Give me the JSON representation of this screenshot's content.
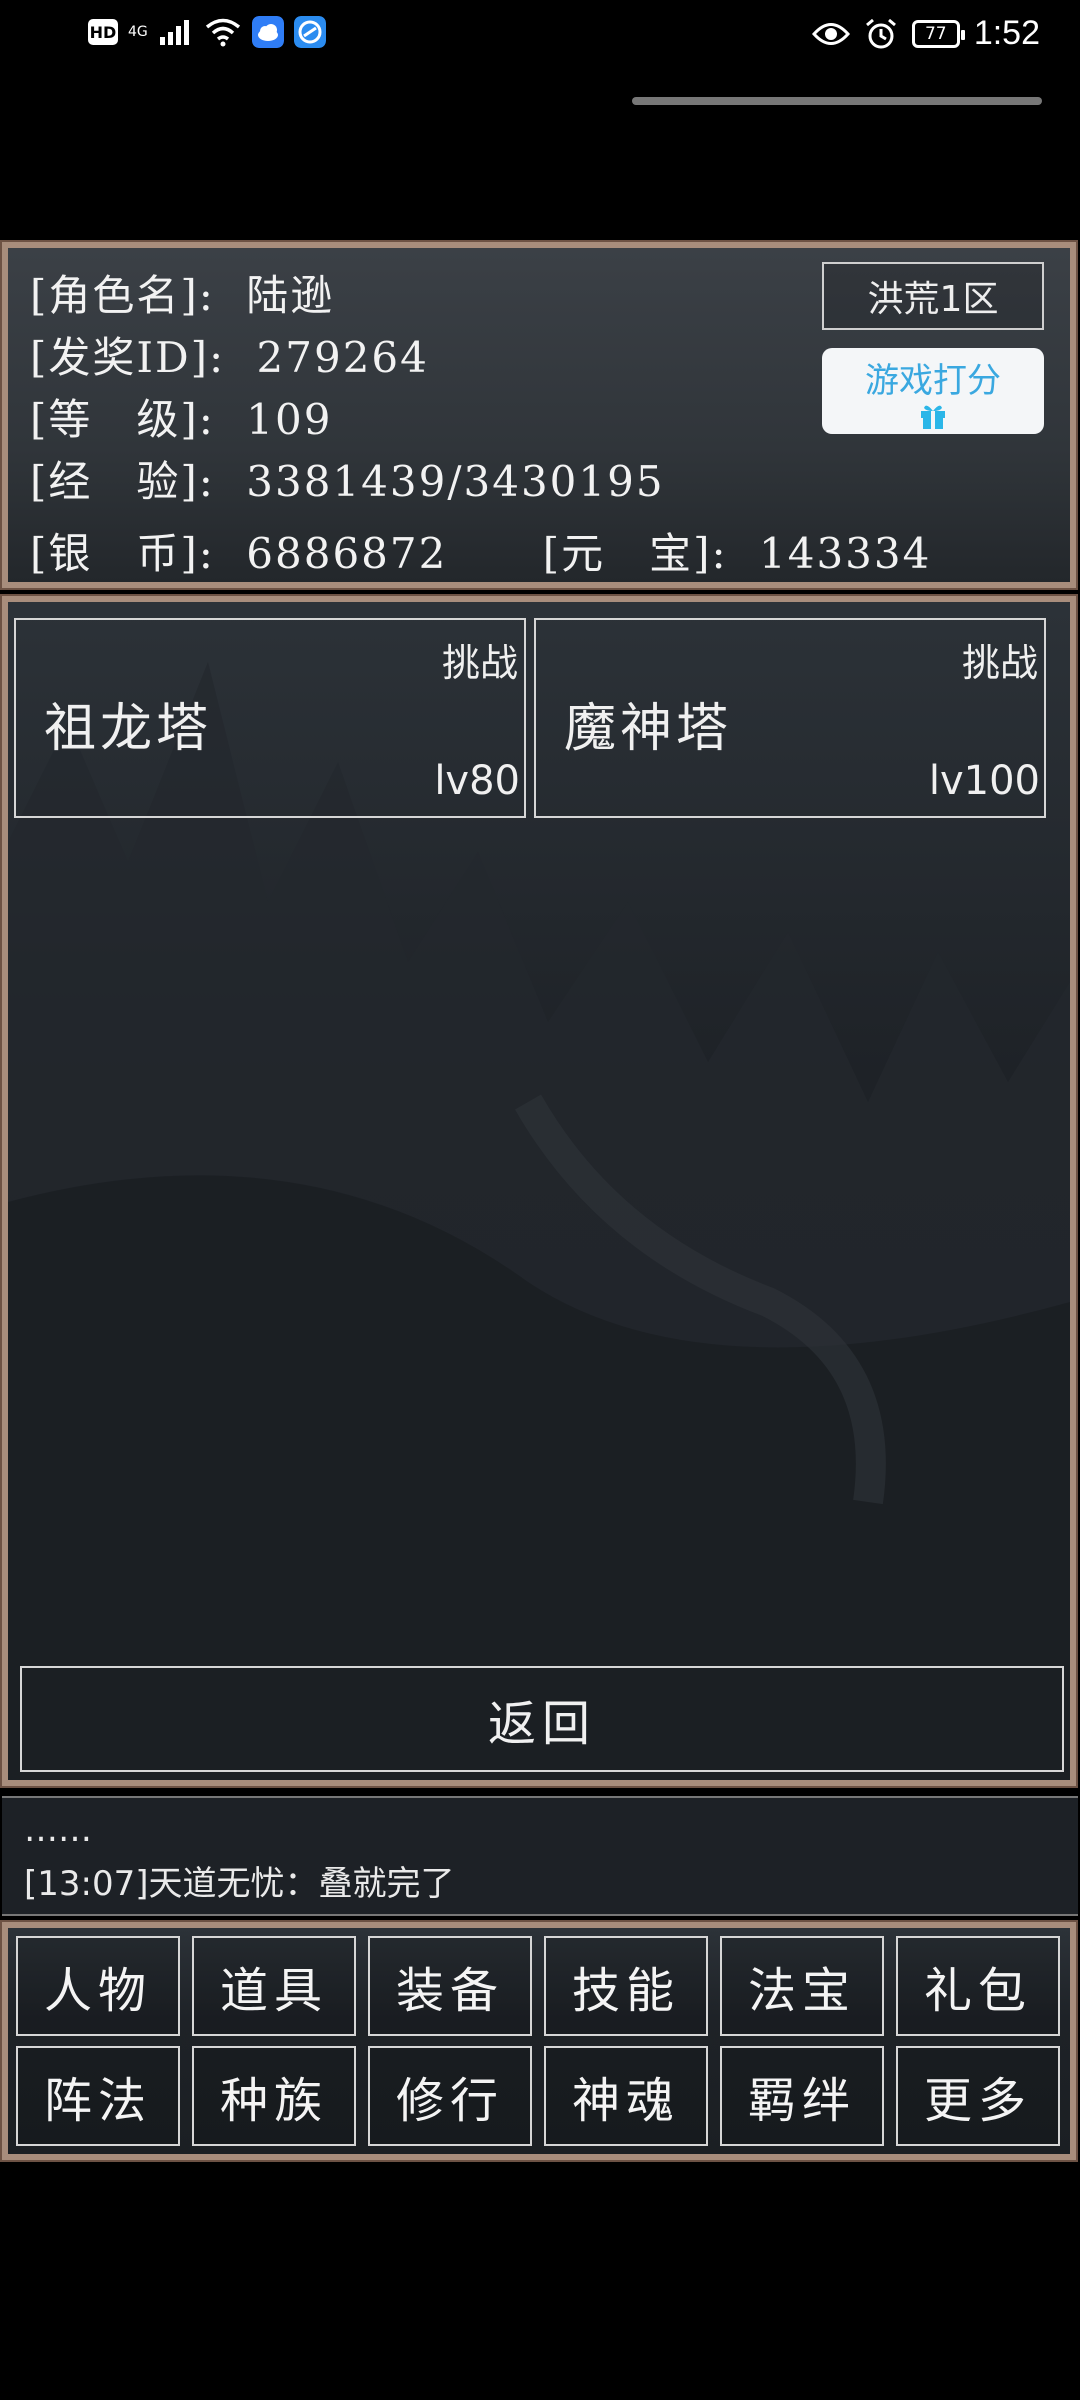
{
  "status_bar": {
    "hd_badge": "HD",
    "network": "4G",
    "battery": "77",
    "time": "1:52"
  },
  "player_info": {
    "name_label": "[角色名]:",
    "name_value": "陆逊",
    "id_label": "[发奖ID]:",
    "id_value": "279264",
    "level_label": "[等　级]:",
    "level_value": "109",
    "exp_label": "[经　验]:",
    "exp_value": "3381439/3430195",
    "silver_label": "[银　币]:",
    "silver_value": "6886872",
    "yuanbao_label": "[元　宝]:",
    "yuanbao_value": "143334",
    "server": "洪荒1区",
    "rate_game": "游戏打分"
  },
  "towers": [
    {
      "name": "祖龙塔",
      "challenge": "挑战",
      "level": "lv80"
    },
    {
      "name": "魔神塔",
      "challenge": "挑战",
      "level": "lv100"
    }
  ],
  "back_label": "返回",
  "chat": {
    "line1": "……",
    "line2": "[13:07]天道无忧：叠就完了"
  },
  "menu": [
    "人物",
    "道具",
    "装备",
    "技能",
    "法宝",
    "礼包",
    "阵法",
    "种族",
    "修行",
    "神魂",
    "羁绊",
    "更多"
  ],
  "colors": {
    "panel_border": "#a88d7c",
    "rate_text": "#3aa8e0",
    "background": "#000000"
  }
}
